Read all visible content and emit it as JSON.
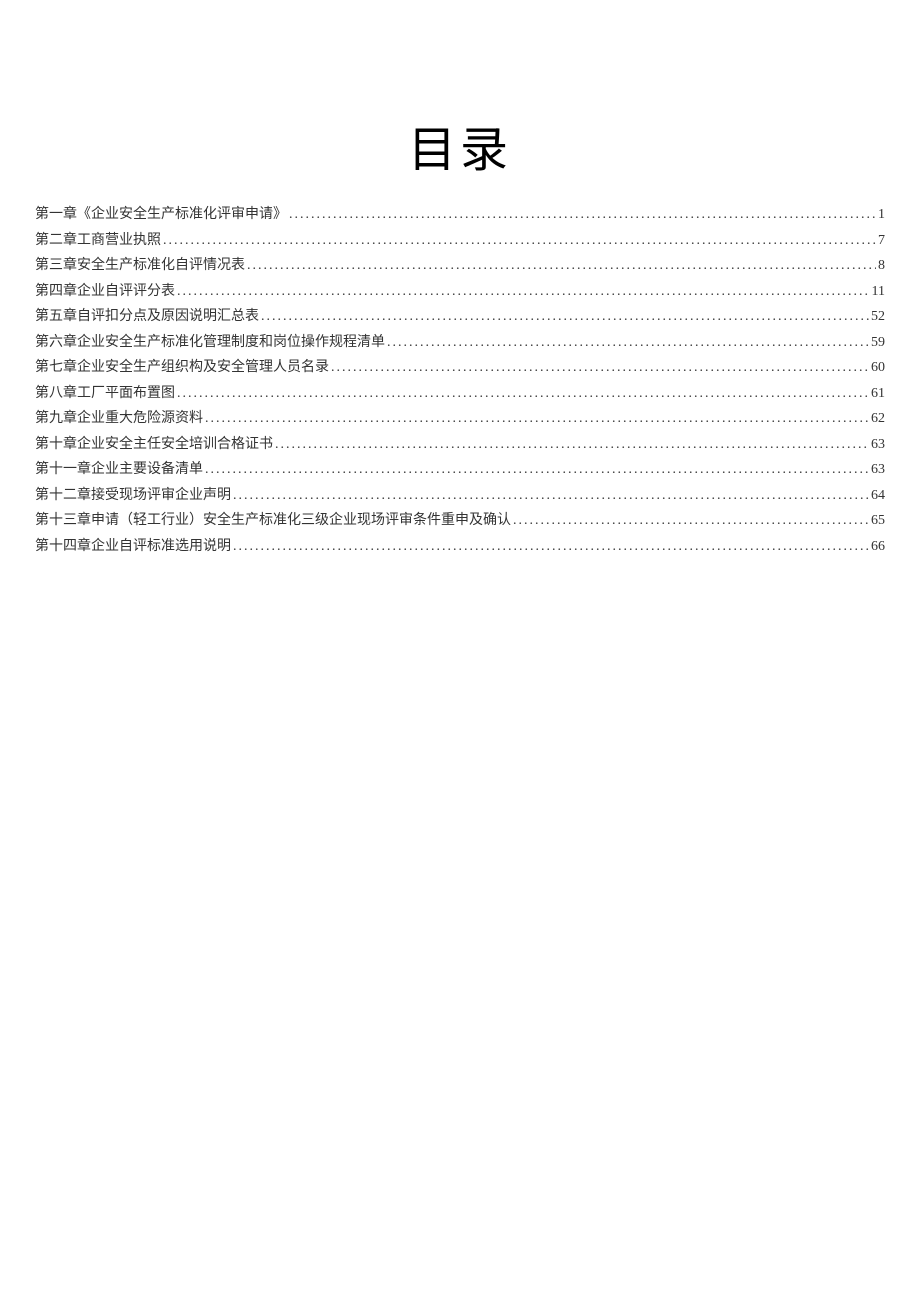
{
  "title": "目录",
  "entries": [
    {
      "label": "第一章《企业安全生产标准化评审申请》",
      "page": "1"
    },
    {
      "label": "第二章工商营业执照",
      "page": "7"
    },
    {
      "label": "第三章安全生产标准化自评情况表",
      "page": "8"
    },
    {
      "label": "第四章企业自评评分表",
      "page": "11"
    },
    {
      "label": "第五章自评扣分点及原因说明汇总表",
      "page": "52"
    },
    {
      "label": "第六章企业安全生产标准化管理制度和岗位操作规程清单",
      "page": "59"
    },
    {
      "label": "第七章企业安全生产组织构及安全管理人员名录",
      "page": "60"
    },
    {
      "label": "第八章工厂平面布置图",
      "page": "61"
    },
    {
      "label": "第九章企业重大危险源资料",
      "page": "62"
    },
    {
      "label": "第十章企业安全主任安全培训合格证书",
      "page": "63"
    },
    {
      "label": "第十一章企业主要设备清单",
      "page": "63"
    },
    {
      "label": "第十二章接受现场评审企业声明",
      "page": "64"
    },
    {
      "label": "第十三章申请（轻工行业）安全生产标准化三级企业现场评审条件重申及确认",
      "page": "65"
    },
    {
      "label": "第十四章企业自评标准选用说明",
      "page": "66"
    }
  ]
}
